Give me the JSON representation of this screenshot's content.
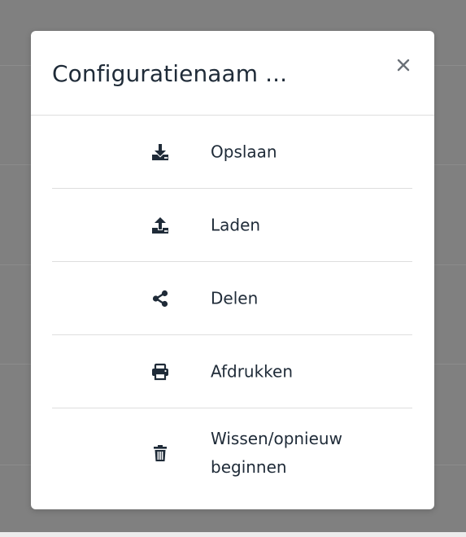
{
  "dialog": {
    "title": "Configuratienaam ...",
    "close_icon": "close-icon",
    "items": [
      {
        "label": "Opslaan",
        "icon": "download-icon"
      },
      {
        "label": "Laden",
        "icon": "upload-icon"
      },
      {
        "label": "Delen",
        "icon": "share-icon"
      },
      {
        "label": "Afdrukken",
        "icon": "print-icon"
      },
      {
        "label": "Wissen/opnieuw beginnen",
        "icon": "trash-icon"
      }
    ]
  },
  "colors": {
    "overlay": "#808080",
    "modal_bg": "#ffffff",
    "text": "#1f2b38",
    "divider": "#dedede"
  }
}
